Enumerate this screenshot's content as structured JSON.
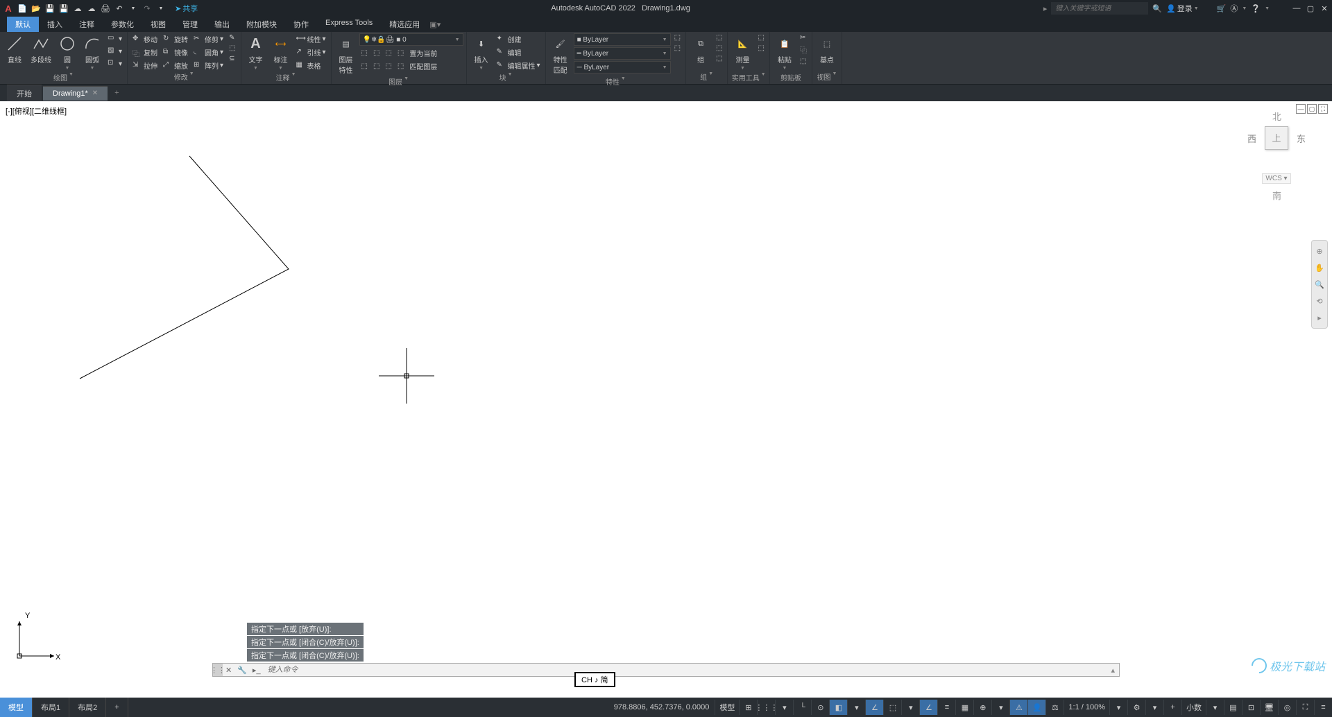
{
  "app": {
    "title": "Autodesk AutoCAD 2022",
    "doc": "Drawing1.dwg"
  },
  "qat_share": "共享",
  "search": {
    "placeholder": "键入关键字或短语"
  },
  "login": "登录",
  "menu_tabs": [
    "默认",
    "插入",
    "注释",
    "参数化",
    "视图",
    "管理",
    "输出",
    "附加模块",
    "协作",
    "Express Tools",
    "精选应用"
  ],
  "ribbon": {
    "draw": {
      "line": "直线",
      "pline": "多段线",
      "circle": "圆",
      "arc": "圆弧",
      "title": "绘图"
    },
    "modify": {
      "move": "移动",
      "rotate": "旋转",
      "trim": "修剪",
      "copy": "复制",
      "mirror": "镜像",
      "fillet": "圆角",
      "stretch": "拉伸",
      "scale": "缩放",
      "array": "阵列",
      "title": "修改"
    },
    "anno": {
      "text": "文字",
      "dim": "标注",
      "leader": "引线",
      "table": "表格",
      "linetype": "线性",
      "title": "注释"
    },
    "layer": {
      "props": "图层\n特性",
      "current": "0",
      "make": "置为当前",
      "match": "匹配图层",
      "title": "图层"
    },
    "block": {
      "insert": "插入",
      "create": "创建",
      "edit": "编辑",
      "attr": "编辑属性",
      "title": "块"
    },
    "props": {
      "match": "特性\n匹配",
      "bylayer": "ByLayer",
      "bylayer2": "ByLayer",
      "bylayer3": "ByLayer",
      "title": "特性"
    },
    "group": {
      "group": "组",
      "title": "组"
    },
    "util": {
      "measure": "测量",
      "title": "实用工具"
    },
    "clip": {
      "paste": "粘贴",
      "title": "剪贴板"
    },
    "view": {
      "base": "基点",
      "title": "视图"
    }
  },
  "filetabs": {
    "start": "开始",
    "drawing": "Drawing1*"
  },
  "viewport_label": "[-][俯视][二维线框]",
  "viewcube": {
    "n": "北",
    "s": "南",
    "e": "东",
    "w": "西",
    "top": "上",
    "wcs": "WCS"
  },
  "ucs": {
    "x": "X",
    "y": "Y"
  },
  "cmd_history": [
    "指定下一点或 [放弃(U)]:",
    "指定下一点或 [闭合(C)/放弃(U)]:",
    "指定下一点或 [闭合(C)/放弃(U)]:"
  ],
  "cmdline": {
    "placeholder": "键入命令"
  },
  "ime": "CH ♪ 简",
  "status": {
    "layouts": [
      "模型",
      "布局1",
      "布局2"
    ],
    "coords": "978.8806, 452.7376, 0.0000",
    "model": "模型",
    "scale": "1:1 / 100%",
    "dec": "小数"
  },
  "watermark": "极光下载站"
}
